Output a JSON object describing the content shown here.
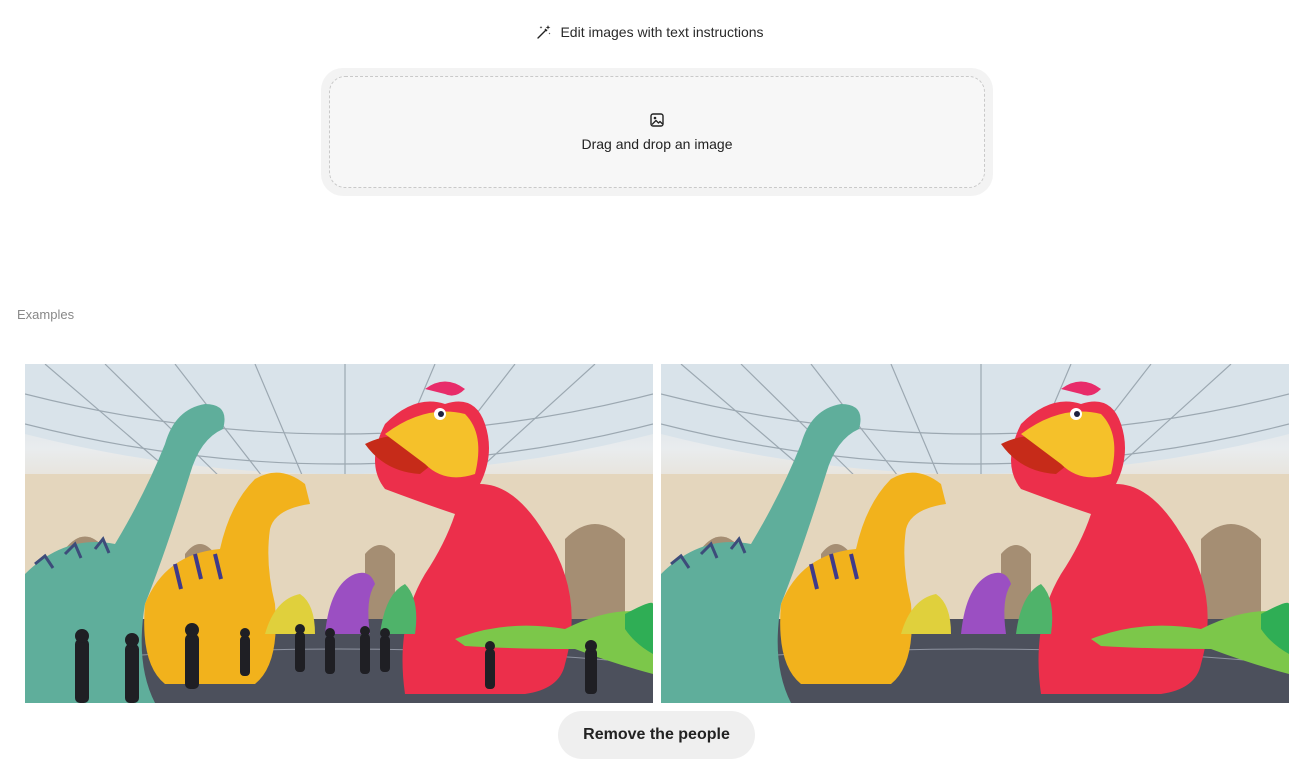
{
  "header": {
    "hint_text": "Edit images with text instructions",
    "hint_icon": "magic-wand-icon"
  },
  "upload": {
    "icon": "image-icon",
    "label": "Drag and drop an image"
  },
  "examples": {
    "label": "Examples",
    "items": [
      {
        "before_image": "inflatable-dinosaurs-with-people",
        "after_image": "inflatable-dinosaurs-without-people",
        "prompt": "Remove the people"
      }
    ]
  },
  "colors": {
    "dino_teal": "#5fae9b",
    "dino_yellow": "#f2b21c",
    "dino_red": "#ec2f4b",
    "dino_green": "#7cc74a",
    "dino_purple": "#9b4fc2",
    "pill_bg": "#efefef"
  }
}
